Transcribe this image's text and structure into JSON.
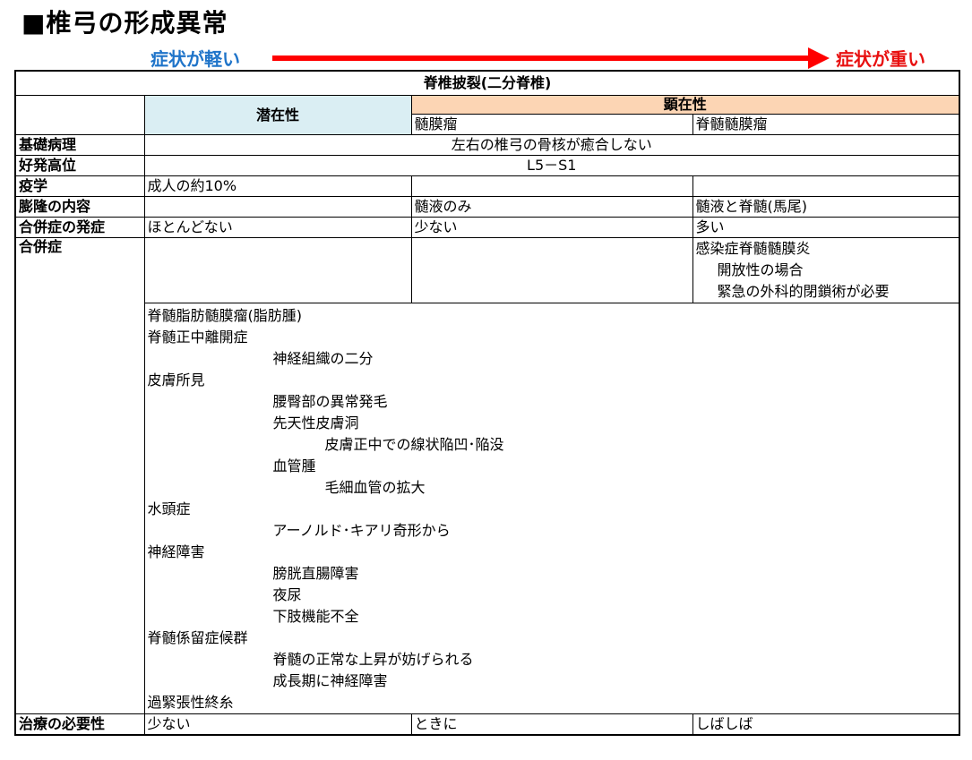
{
  "page": {
    "title": "■椎弓の形成異常"
  },
  "severity": {
    "light": "症状が軽い",
    "heavy": "症状が重い",
    "arrow_color": "#ff0000"
  },
  "table": {
    "caption": "脊椎披裂(二分脊椎)",
    "latent": "潜在性",
    "overt": "顕在性",
    "sub1": "髄膜瘤",
    "sub2": "脊髄髄膜瘤",
    "rows": {
      "pathology": {
        "label": "基礎病理",
        "value": "左右の椎弓の骨核が癒合しない"
      },
      "site": {
        "label": "好発高位",
        "value": "L5－S1"
      },
      "epidemiology": {
        "label": "疫学",
        "latent": "成人の約10%",
        "sub1": "",
        "sub2": ""
      },
      "content": {
        "label": "膨隆の内容",
        "latent": "",
        "sub1": "髄液のみ",
        "sub2": "髄液と脊髄(馬尾)"
      },
      "onset": {
        "label": "合併症の発症",
        "latent": "ほとんどない",
        "sub1": "少ない",
        "sub2": "多い"
      },
      "complication": {
        "label": "合併症",
        "sub2_lines": [
          "感染症脊髄髄膜炎",
          "開放性の場合",
          "緊急の外科的閉鎖術が必要"
        ],
        "latent_lines": [
          "脊髄脂肪髄膜瘤(脂肪腫)",
          "脊髄正中離開症",
          "神経組織の二分",
          "皮膚所見",
          "腰臀部の異常発毛",
          "先天性皮膚洞",
          "皮膚正中での線状陥凹･陥没",
          "血管腫",
          "毛細血管の拡大",
          "水頭症",
          "アーノルド･キアリ奇形から",
          "神経障害",
          "膀胱直腸障害",
          "夜尿",
          "下肢機能不全",
          "脊髄係留症候群",
          "脊髄の正常な上昇が妨げられる",
          "成長期に神経障害",
          "過緊張性終糸"
        ]
      },
      "treatment": {
        "label": "治療の必要性",
        "latent": "少ない",
        "sub1": "ときに",
        "sub2": "しばしば"
      }
    }
  },
  "colors": {
    "latent_bg": "#daeef3",
    "overt_bg": "#fcd5b4",
    "light_text": "#1f74c9",
    "heavy_text": "#e81010"
  }
}
